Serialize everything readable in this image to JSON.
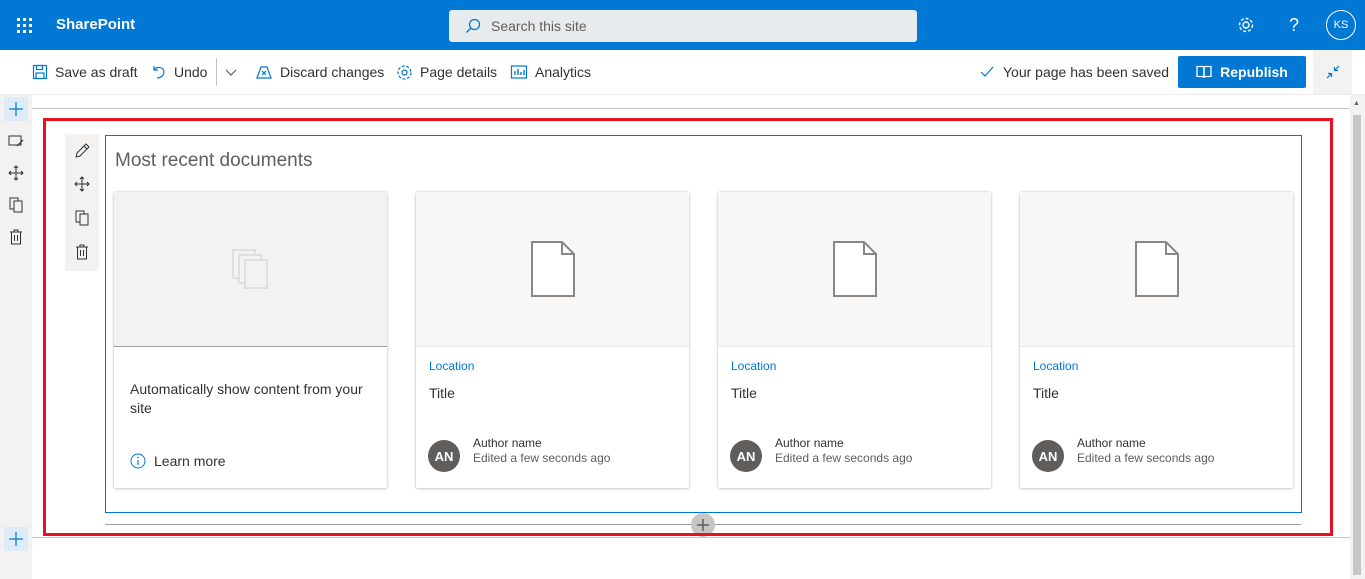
{
  "suitebar": {
    "brand": "SharePoint",
    "search_placeholder": "Search this site",
    "avatar_initials": "KS",
    "help_glyph": "?"
  },
  "commandbar": {
    "save_draft": "Save as draft",
    "undo": "Undo",
    "discard": "Discard changes",
    "page_details": "Page details",
    "analytics": "Analytics",
    "saved_status": "Your page has been saved",
    "republish": "Republish"
  },
  "webpart": {
    "title": "Most recent documents",
    "intro_card": {
      "text": "Automatically show content from your site",
      "learn_more": "Learn more"
    },
    "cards": [
      {
        "location": "Location",
        "title": "Title",
        "avatar": "AN",
        "author": "Author name",
        "edited": "Edited a few seconds ago"
      },
      {
        "location": "Location",
        "title": "Title",
        "avatar": "AN",
        "author": "Author name",
        "edited": "Edited a few seconds ago"
      },
      {
        "location": "Location",
        "title": "Title",
        "avatar": "AN",
        "author": "Author name",
        "edited": "Edited a few seconds ago"
      }
    ]
  },
  "colors": {
    "brand": "#0078d4",
    "highlight": "#e81123"
  },
  "icons": [
    "waffle-icon",
    "search-icon",
    "gear-icon",
    "help-icon",
    "save-icon",
    "undo-icon",
    "chevron-down-icon",
    "discard-icon",
    "page-details-icon",
    "analytics-icon",
    "checkmark-icon",
    "book-icon",
    "collapse-icon",
    "plus-icon",
    "edit-icon",
    "move-icon",
    "duplicate-icon",
    "trash-icon",
    "document-icon",
    "info-icon"
  ]
}
